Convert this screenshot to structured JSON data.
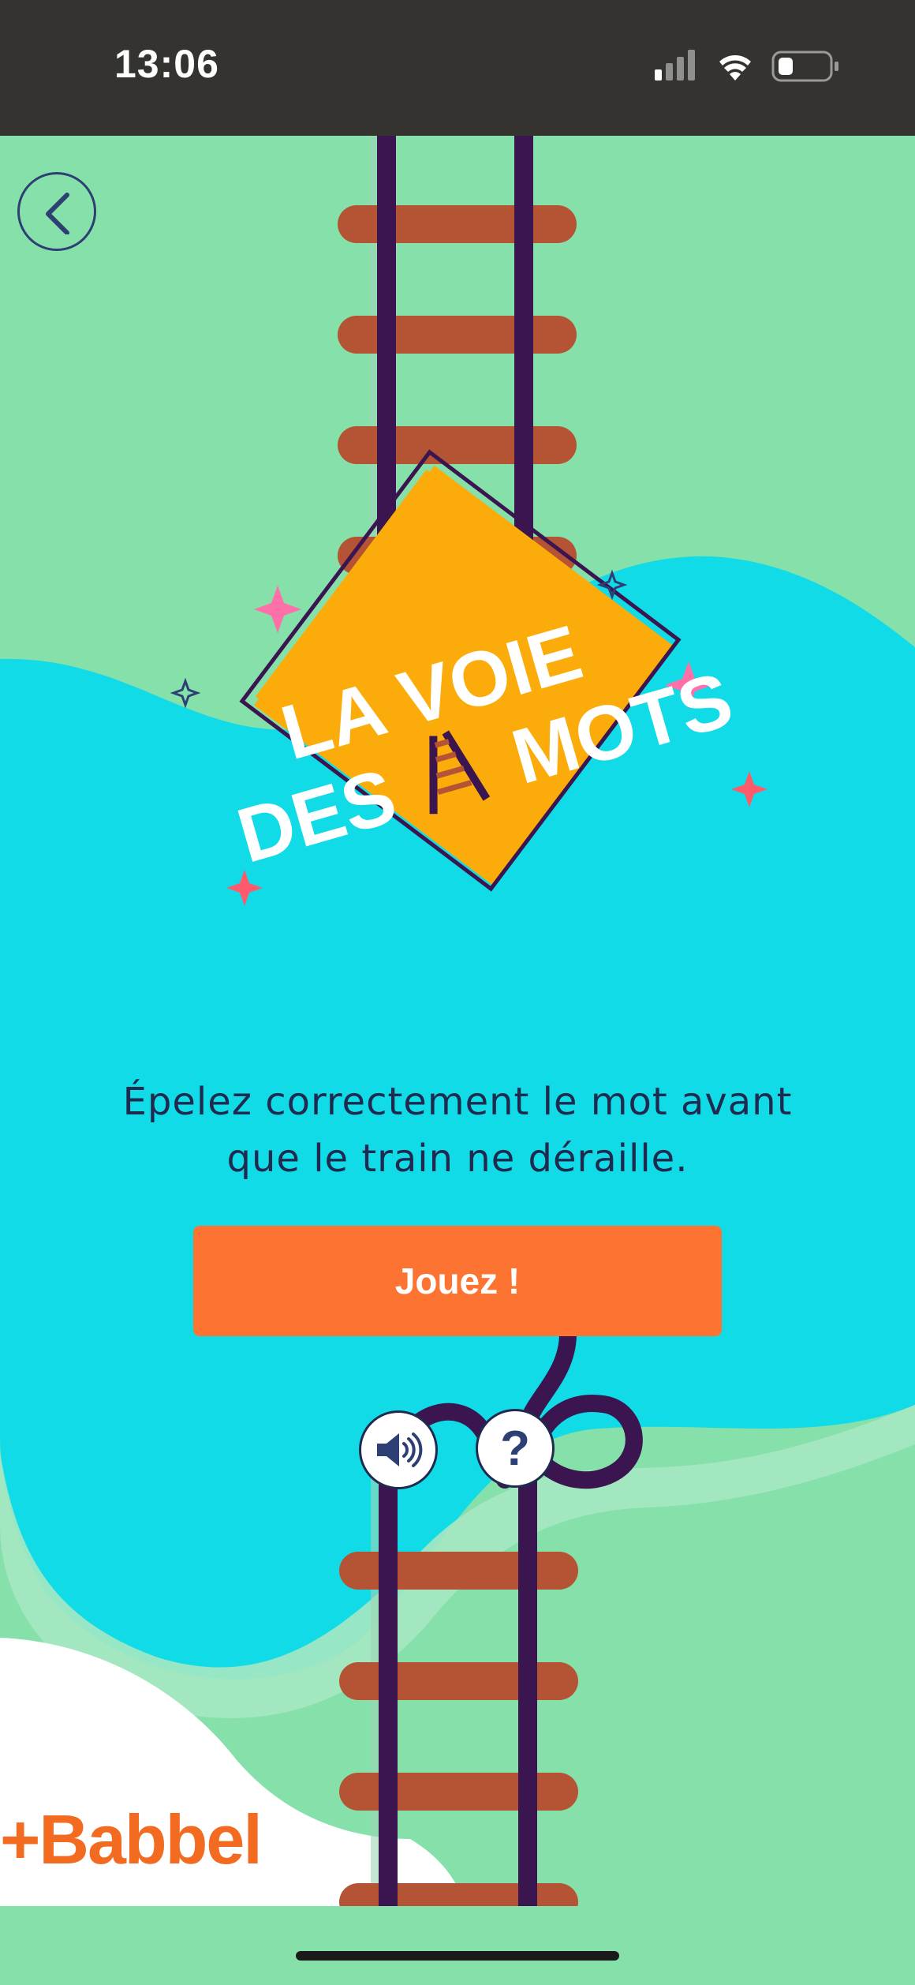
{
  "status_bar": {
    "time": "13:06"
  },
  "game": {
    "title_line1": "LA VOIE",
    "title_line2_a": "DES",
    "title_line2_b": "MOTS"
  },
  "instruction": {
    "line1": "Épelez correctement le mot avant",
    "line2": "que le train ne déraille."
  },
  "play_label": "Jouez !",
  "help_label": "?",
  "brand": "+Babbel",
  "icons": {
    "back": "chevron-left-icon",
    "sound": "speaker-icon",
    "help": "question-icon",
    "signal": "signal-icon",
    "wifi": "wifi-icon",
    "battery": "battery-icon"
  },
  "colors": {
    "background_green": "#86e0aa",
    "water_cyan": "#12dbe8",
    "sign_orange": "#fcac0a",
    "button_orange": "#fd7432",
    "rail_purple": "#3a1550",
    "sleeper_brown": "#b55335",
    "text_navy": "#1f2a4e",
    "brand_orange": "#f26b21",
    "status_bar": "#343330"
  }
}
